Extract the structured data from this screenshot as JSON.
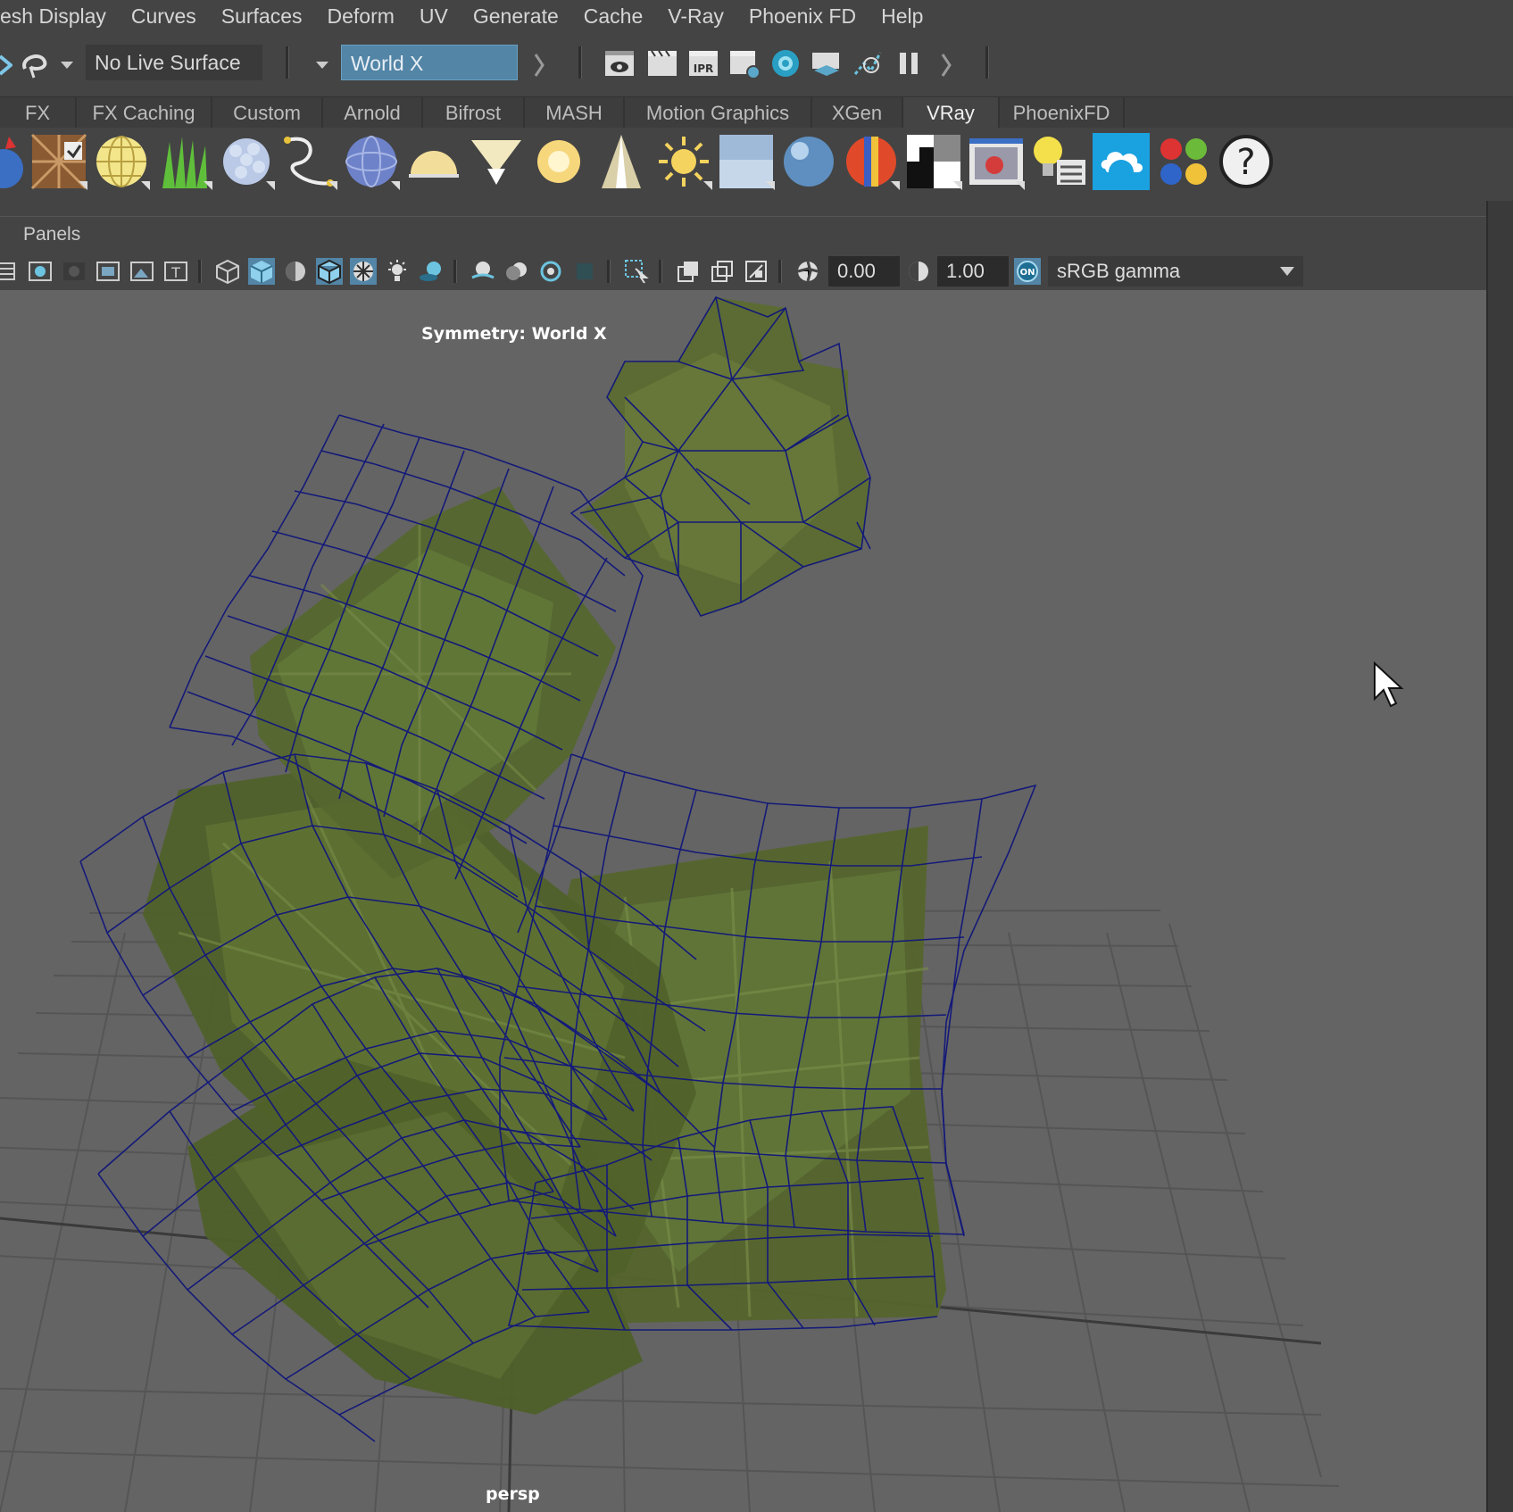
{
  "menu": [
    "esh Display",
    "Curves",
    "Surfaces",
    "Deform",
    "UV",
    "Generate",
    "Cache",
    "V-Ray",
    "Phoenix FD",
    "Help"
  ],
  "status_line": {
    "live_surface": "No Live Surface",
    "symmetry_mode": "World X",
    "ipr_label": "IPR"
  },
  "shelf_tabs": [
    {
      "label": "FX",
      "active": false
    },
    {
      "label": "FX Caching",
      "active": false
    },
    {
      "label": "Custom",
      "active": false
    },
    {
      "label": "Arnold",
      "active": false
    },
    {
      "label": "Bifrost",
      "active": false
    },
    {
      "label": "MASH",
      "active": false
    },
    {
      "label": "Motion Graphics",
      "active": false
    },
    {
      "label": "XGen",
      "active": false
    },
    {
      "label": "VRay",
      "active": true
    },
    {
      "label": "PhoenixFD",
      "active": false
    }
  ],
  "shelf_icons": [
    "vray-light-icon",
    "vray-material-icon",
    "dome-sphere-icon",
    "fur-icon",
    "sphere-fade-icon",
    "curve-icon",
    "blue-sphere-icon",
    "dome-light-icon",
    "spot-light-icon",
    "sphere-light-icon",
    "ies-light-icon",
    "sun-icon",
    "plane-light-icon",
    "blinn-sphere-icon",
    "flag-sphere-icon",
    "checker-icon",
    "frame-buffer-icon",
    "light-lister-icon",
    "cloud-icon",
    "multi-sphere-icon",
    "help-icon"
  ],
  "panels": {
    "menu_label": "Panels",
    "exposure": "0.00",
    "gamma": "1.00",
    "toggle_label": "ON",
    "color_space": "sRGB gamma"
  },
  "viewport": {
    "symmetry_text": "Symmetry: World X",
    "camera_label": "persp"
  },
  "colors": {
    "ui_bg": "#444444",
    "viewport_bg": "#646464",
    "wire": "#141a78",
    "leaf": "#5a6a2e",
    "accent": "#5285a6"
  }
}
